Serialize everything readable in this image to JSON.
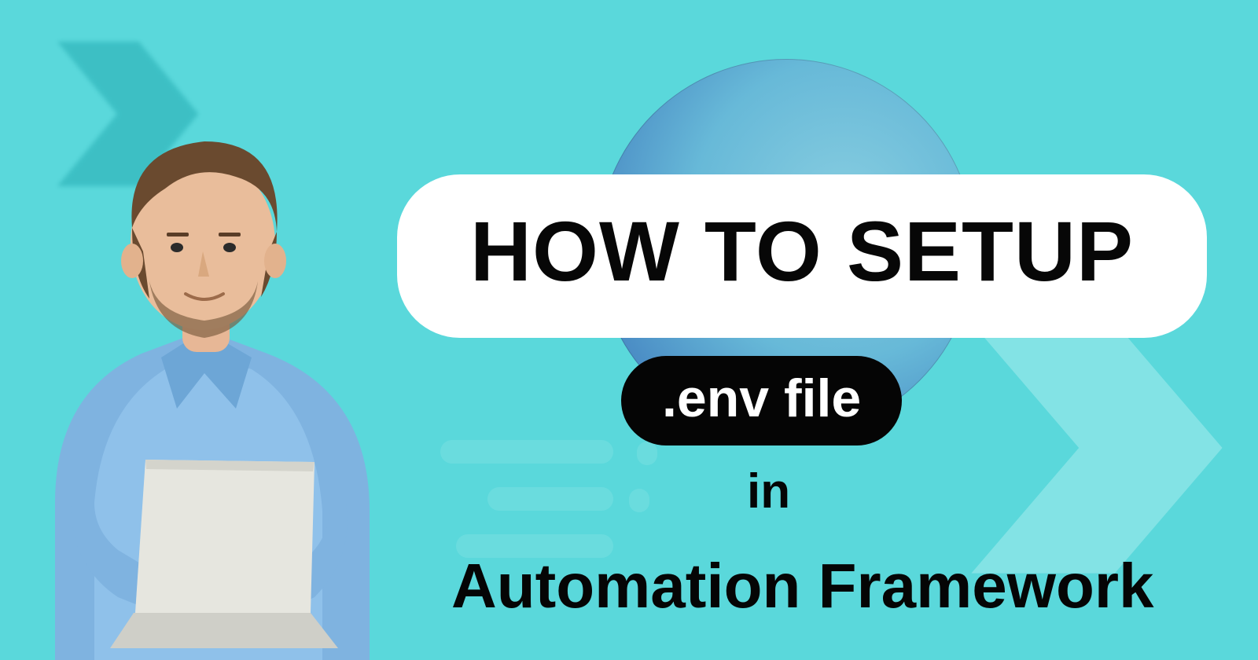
{
  "title_main": "HOW TO SETUP",
  "env_label": ".env file",
  "word_in": "in",
  "framework_line": "Automation Framework"
}
